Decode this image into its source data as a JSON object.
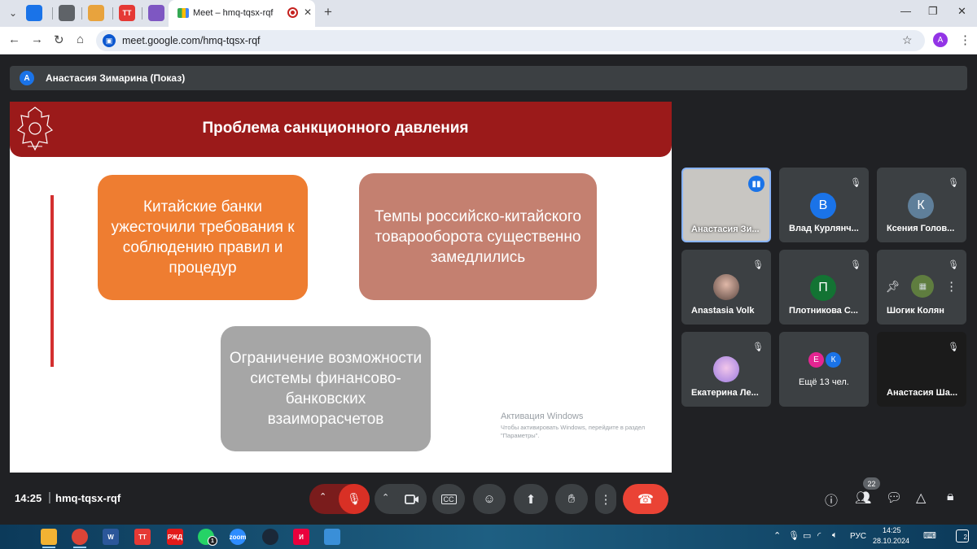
{
  "browser": {
    "tab_title": "Meet – hmq-tqsx-rqf",
    "pinned_tabs": [
      {
        "icon": "mail-icon",
        "label": "",
        "color": "#1a73e8"
      },
      {
        "icon": "profile-icon",
        "label": "",
        "color": "#5f6368"
      },
      {
        "icon": "slides-icon",
        "label": "",
        "color": "#e8a33d"
      },
      {
        "icon": "tt-icon",
        "label": "TT",
        "color": "#e53935"
      },
      {
        "icon": "chat-icon",
        "label": "",
        "color": "#7e57c2"
      }
    ],
    "new_tab": "+",
    "url": "meet.google.com/hmq-tqsx-rqf",
    "profile_initial": "A"
  },
  "presenter": {
    "initial": "A",
    "name": "Анастасия Зимарина (Показ)"
  },
  "slide": {
    "title": "Проблема санкционного давления",
    "boxes": [
      {
        "text": "Китайские банки ужесточили требования к соблюдению правил и процедур",
        "color": "#ee7d31"
      },
      {
        "text": "Темпы российско-китайского товарооборота существенно замедлились",
        "color": "#c48070"
      },
      {
        "text": "Ограничение возможности системы финансово-банковских взаиморасчетов",
        "color": "#a6a6a6"
      }
    ],
    "watermark_title": "Активация Windows",
    "watermark_text": "Чтобы активировать Windows, перейдите в раздел \"Параметры\"."
  },
  "participants": [
    {
      "name": "Анастасия Зи...",
      "speaking": true
    },
    {
      "name": "Влад Курлянч...",
      "initial": "В",
      "color": "#1a73e8"
    },
    {
      "name": "Ксения Голов...",
      "initial": "К",
      "color": "#5f7f9a"
    },
    {
      "name": "Anastasia Volk"
    },
    {
      "name": "Плотникова С...",
      "initial": "П",
      "color": "#137333"
    },
    {
      "name": "Шогик Колян"
    },
    {
      "name": "Екатерина Ле..."
    },
    {
      "name": "Ещё 13 чел.",
      "initials": [
        "Е",
        "К"
      ],
      "colors": [
        "#e52592",
        "#1a73e8"
      ]
    },
    {
      "name": "Анастасия Ша..."
    }
  ],
  "meeting": {
    "time": "14:25",
    "separator": "|",
    "code": "hmq-tqsx-rqf",
    "people_count": "22"
  },
  "taskbar": {
    "apps": [
      {
        "icon": "file-explorer-icon",
        "label": "",
        "color": "#f2b233"
      },
      {
        "icon": "chrome-icon",
        "label": "",
        "color": "#db4437"
      },
      {
        "icon": "word-icon",
        "label": "W",
        "color": "#2b579a"
      },
      {
        "icon": "tt-app-icon",
        "label": "TT",
        "color": "#e53935"
      },
      {
        "icon": "rzd-icon",
        "label": "РЖД",
        "color": "#e21a1a"
      },
      {
        "icon": "whatsapp-icon",
        "label": "",
        "color": "#25d366"
      },
      {
        "icon": "zoom-icon",
        "label": "zoom",
        "color": "#2d8cff"
      },
      {
        "icon": "steam-icon",
        "label": "",
        "color": "#1b2838"
      },
      {
        "icon": "ivi-icon",
        "label": "И",
        "color": "#ea003d"
      },
      {
        "icon": "ie-icon",
        "label": "",
        "color": "#3a8fd8"
      }
    ],
    "whatsapp_badge": "1",
    "lang": "РУС",
    "time": "14:25",
    "date": "28.10.2024",
    "notifications": "2"
  }
}
